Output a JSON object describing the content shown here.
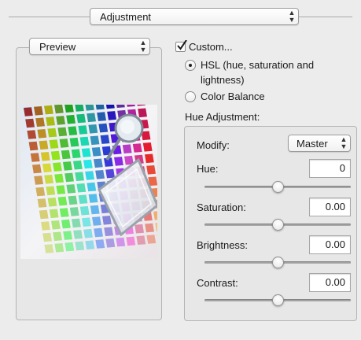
{
  "adjustment_popup": {
    "label": "Adjustment"
  },
  "preview_popup": {
    "label": "Preview"
  },
  "custom_checkbox": {
    "label": "Custom...",
    "checked": true
  },
  "options": [
    {
      "label_line1": "HSL (hue, saturation and",
      "label_line2": "lightness)",
      "selected": true
    },
    {
      "label": "Color Balance",
      "selected": false
    }
  ],
  "hue_adjustment": {
    "title": "Hue Adjustment:",
    "modify_label": "Modify:",
    "modify_value": "Master",
    "sliders": [
      {
        "label": "Hue:",
        "value": "0",
        "level": 0.5
      },
      {
        "label": "Saturation:",
        "value": "0.00",
        "level": 0.5
      },
      {
        "label": "Brightness:",
        "value": "0.00",
        "level": 0.5
      },
      {
        "label": "Contrast:",
        "value": "0.00",
        "level": 0.5
      }
    ]
  }
}
